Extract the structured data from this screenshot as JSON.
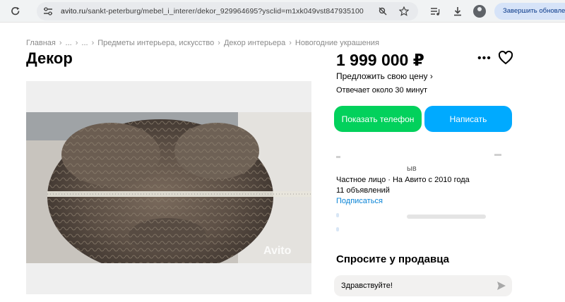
{
  "browser": {
    "url_host": "avito.ru",
    "url_path": "/sankt-peterburg/mebel_i_interer/dekor_929964695?ysclid=m1xk049vst847935100",
    "update_label": "Завершить обновление",
    "icons": [
      "reload-icon",
      "site-info-icon",
      "no-track-icon",
      "star-icon",
      "playlist-icon",
      "download-icon",
      "profile-icon"
    ]
  },
  "breadcrumb": {
    "items": [
      "Главная",
      "...",
      "...",
      "Предметы интерьера, искусство",
      "Декор интерьера",
      "Новогодние украшения"
    ],
    "separator": "›"
  },
  "listing": {
    "title": "Декор",
    "price": "1 999 000 ₽",
    "offer_link": "Предложить свою цену ›",
    "response_time": "Отвечает около 30 минут"
  },
  "actions": {
    "phone_label": "Показать телефон",
    "write_label": "Написать",
    "phone_color": "#02d15c",
    "write_color": "#00aaff"
  },
  "seller": {
    "name_partial": "ыв",
    "type": "Частное лицо · На Авито с 2010 года",
    "listings": "11 объявлений",
    "subscribe": "Подписаться"
  },
  "photo": {
    "watermark": "Avito"
  },
  "ask": {
    "title": "Спросите у продавца",
    "input_value": "Здравствуйте!"
  }
}
